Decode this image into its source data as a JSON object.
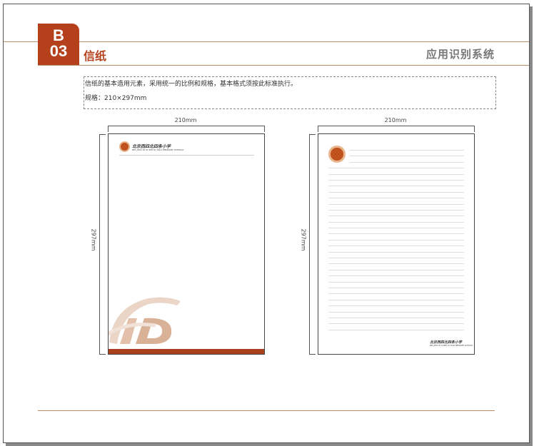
{
  "section": {
    "badge_letter": "B",
    "badge_number": "03",
    "title": "信纸",
    "system_name": "应用识别系统"
  },
  "description": {
    "line1": "信纸的基本造用元素，采用统一的比例和规格，基本格式须按此标准执行。",
    "line2": "规格：210×297mm"
  },
  "letterhead_left": {
    "width_label": "210mm",
    "height_label": "297mm",
    "school_name": "北京西四北四条小学",
    "school_name_en": "BEI JING XI SI BEI SI TIAO PRIMARY SCHOOL",
    "accent_color": "#a8401c"
  },
  "letterhead_right": {
    "width_label": "210mm",
    "height_label": "297mm",
    "school_name": "北京西四北四条小学",
    "school_name_en": "BEI JING XI SI BEI SI TIAO PRIMARY SCHOOL"
  },
  "colors": {
    "brand": "#b5401c",
    "rule": "#b9906c"
  }
}
